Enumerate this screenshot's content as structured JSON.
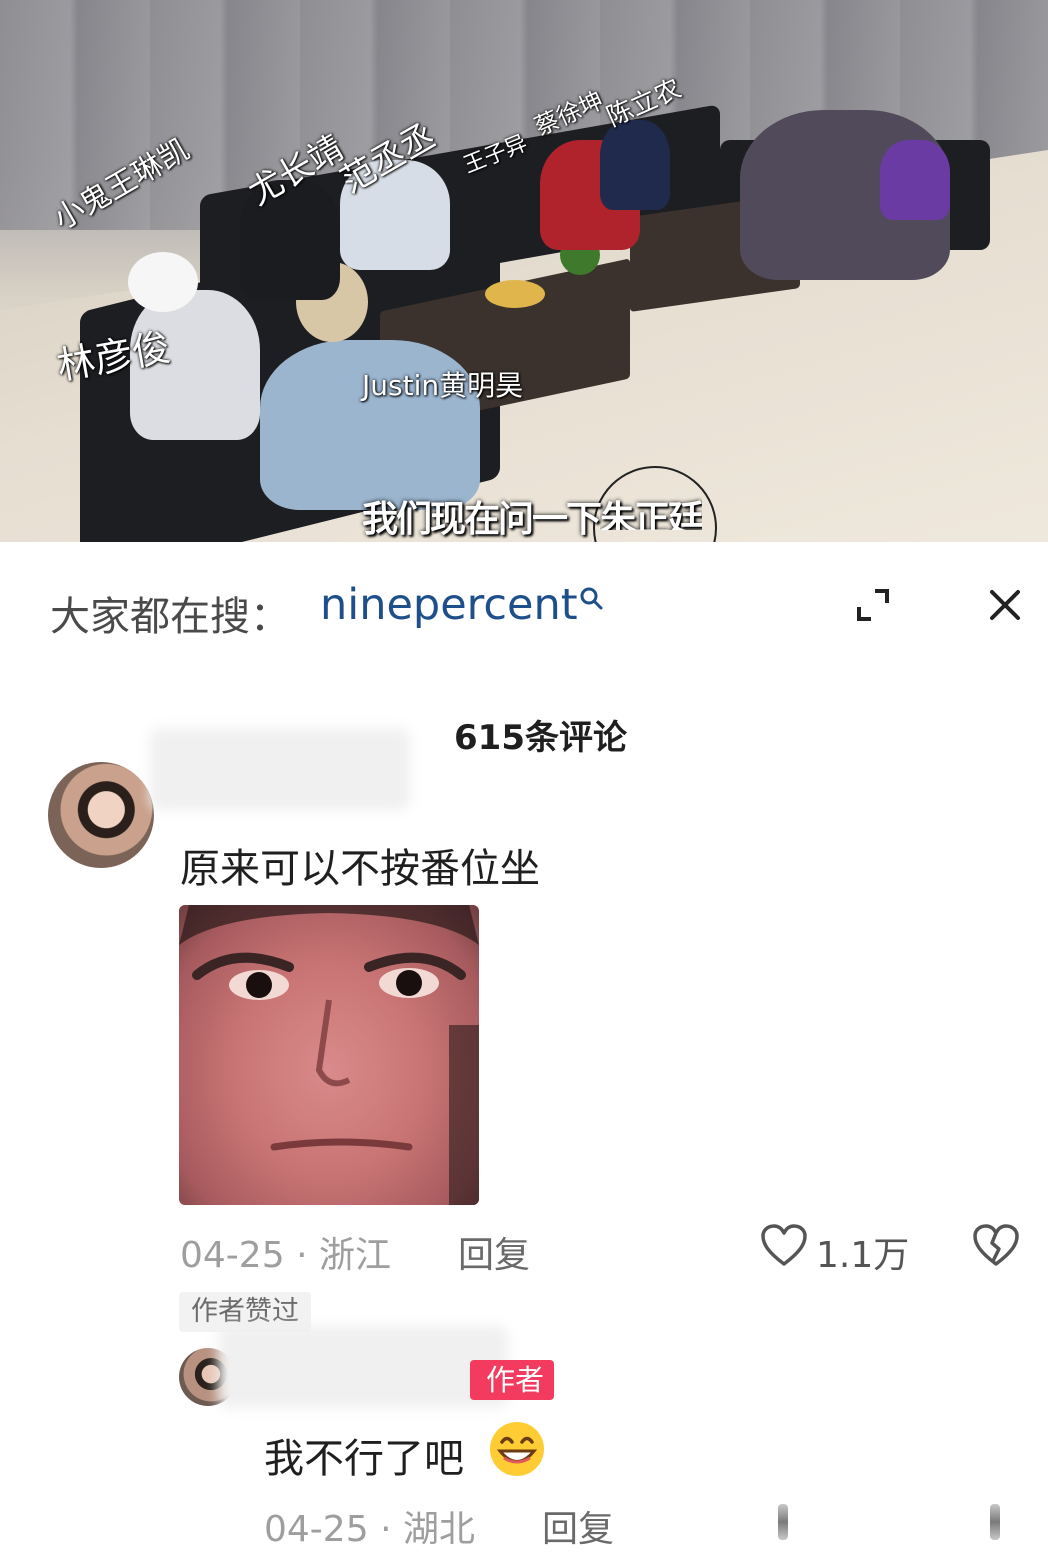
{
  "video": {
    "labels": [
      "小鬼王琳凯",
      "尤长靖",
      "范丞丞",
      "王子异",
      "蔡徐坤",
      "陈立农",
      "林彦俊",
      "Justin黄明昊"
    ],
    "subtitle": "我们现在问一下",
    "subtitle_cut": "朱正廷"
  },
  "search_bar": {
    "prefix": "大家都在搜：",
    "keyword": "ninepercent",
    "keyword_icon": "search-icon",
    "expand_icon": "expand-icon",
    "close_icon": "close-icon"
  },
  "comments_header": {
    "count_label": "615条评论"
  },
  "comment": {
    "text": "原来可以不按番位坐",
    "date": "04-25",
    "location": "浙江",
    "separator": "·",
    "reply_label": "回复",
    "like_count": "1.1万",
    "like_icon": "heart-outline-icon",
    "dislike_icon": "broken-heart-icon",
    "author_liked": "作者赞过"
  },
  "reply": {
    "badge": "作者",
    "text": "我不行了吧",
    "emoji": "grinning-face-emoji",
    "date": "04-25",
    "location": "湖北",
    "separator": "·",
    "reply_label": "回复"
  },
  "colors": {
    "keyword": "#1e4f8a",
    "author_badge": "#f23b5e",
    "meta_gray": "#9e9e9e"
  }
}
